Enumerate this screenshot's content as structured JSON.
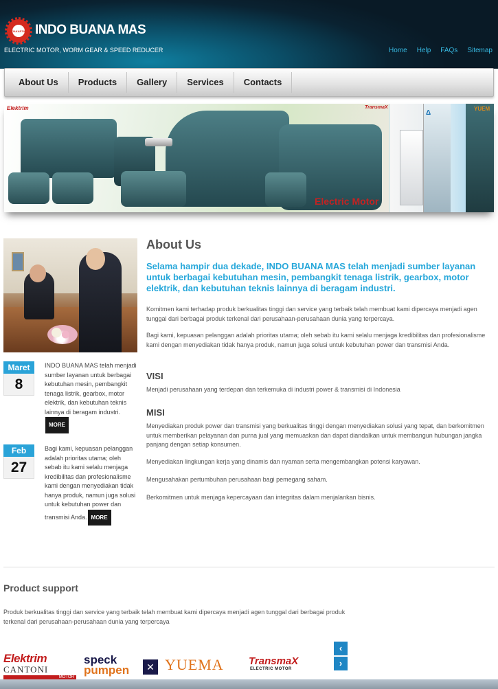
{
  "header": {
    "brand": "INDO BUANA MAS",
    "logo_text": "JAKARTA",
    "tagline": "ELECTRIC MOTOR, WORM GEAR & SPEED REDUCER",
    "top_links": [
      "Home",
      "Help",
      "FAQs",
      "Sitemap"
    ],
    "accent": "#37b8e0"
  },
  "nav": {
    "items": [
      "About  Us",
      "Products",
      "Gallery",
      "Services",
      "Contacts"
    ]
  },
  "banner": {
    "caption": "Electric Motor",
    "brand_left": "Elektrim",
    "brand_transmax": "TransmaX",
    "brand_delta": "Δ",
    "brand_yuema": "YUEM"
  },
  "news": [
    {
      "month": "Maret",
      "day": "8",
      "text": "INDO BUANA MAS telah menjadi sumber layanan untuk berbagai kebutuhan mesin, pembangkit tenaga listrik, gearbox, motor elektrik, dan kebutuhan teknis lainnya di beragam industri.",
      "more": "MORE"
    },
    {
      "month": "Feb",
      "day": "27",
      "text": "Bagi kami, kepuasan pelanggan adalah prioritas utama; oleh sebab itu kami selalu menjaga kredibilitas dan profesionalisme kami dengan menyediakan tidak hanya produk, namun juga solusi untuk kebutuhan power dan transmisi Anda.",
      "more": "MORE"
    }
  ],
  "about": {
    "title": "About Us",
    "lead": "Selama hampir dua dekade, INDO BUANA MAS telah menjadi sumber layanan untuk berbagai kebutuhan mesin, pembangkit tenaga listrik, gearbox, motor elektrik, dan kebutuhan teknis lainnya di beragam industri.",
    "p1": "Komitmen kami terhadap produk berkualitas tinggi dan service yang terbaik telah membuat kami dipercaya menjadi agen tunggal dari berbagai produk terkenal dari perusahaan-perusahaan dunia yang terpercaya.",
    "p2": "Bagi kami, kepuasan pelanggan adalah prioritas utama; oleh sebab itu kami selalu menjaga kredibilitas dan profesionalisme kami dengan menyediakan tidak hanya produk, namun juga solusi untuk kebutuhan power dan transmisi Anda.",
    "visi_title": "VISI",
    "visi": "Menjadi perusahaan yang terdepan dan terkemuka di industri power & transmisi di Indonesia",
    "misi_title": "MISI",
    "misi": [
      "Menyediakan produk power dan transmisi yang berkualitas tinggi dengan menyediakan solusi yang tepat, dan berkomitmen untuk memberikan pelayanan dan purna jual yang memuaskan dan dapat diandalkan untuk membangun hubungan jangka panjang dengan setiap konsumen.",
      "Menyediakan lingkungan kerja yang dinamis dan nyaman serta mengembangkan potensi karyawan.",
      "Mengusahakan pertumbuhan perusahaan bagi pemegang saham.",
      "Berkomitmen untuk menjaga kepercayaan dan integritas dalam menjalankan bisnis."
    ]
  },
  "product_support": {
    "title": "Product support",
    "text": "Produk berkualitas tinggi dan service yang terbaik telah membuat kami dipercaya menjadi agen tunggal dari berbagai produk terkenal dari perusahaan-perusahaan dunia yang terpercaya",
    "logos": {
      "elektrim": "Elektrim",
      "cantoni": "CANTONI",
      "cantoni_sub": "MOTOR",
      "speck_1": "speck",
      "speck_2": "pumpen",
      "yuema": "YUEMA",
      "transmax": "TransmaX",
      "transmax_sub": "ELECTRIC MOTOR"
    },
    "arrow_up": "‹",
    "arrow_down": "›"
  }
}
